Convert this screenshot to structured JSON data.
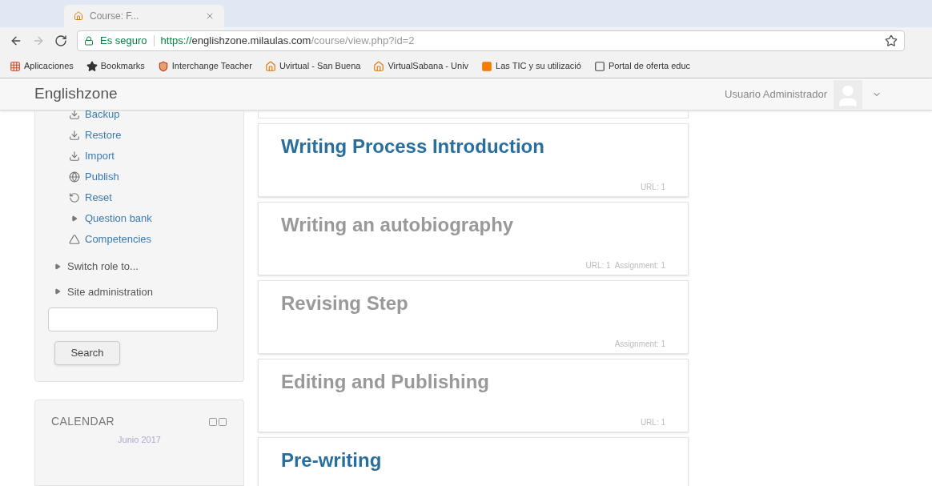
{
  "browser": {
    "tab": {
      "title": "Course: F..."
    },
    "address": {
      "secure_label": "Es seguro",
      "url_host": "https://englishzone.milaulas.com",
      "url_path": "/course/view.php?id=2"
    },
    "bookmarks": [
      {
        "label": "Aplicaciones"
      },
      {
        "label": "Bookmarks"
      },
      {
        "label": "Interchange Teacher"
      },
      {
        "label": "Uvirtual - San Buena"
      },
      {
        "label": "VirtualSabana - Univ"
      },
      {
        "label": "Las TIC y su utilizació"
      },
      {
        "label": "Portal de oferta educ"
      }
    ]
  },
  "navbar": {
    "brand": "Englishzone",
    "user": "Usuario Administrador"
  },
  "admin_menu": {
    "items": [
      {
        "label": "Backup"
      },
      {
        "label": "Restore"
      },
      {
        "label": "Import"
      },
      {
        "label": "Publish"
      },
      {
        "label": "Reset"
      },
      {
        "label": "Question bank"
      },
      {
        "label": "Competencies"
      }
    ],
    "sections": [
      {
        "label": "Switch role to...",
        "expanded": false
      },
      {
        "label": "Site administration",
        "expanded": false
      }
    ],
    "search_button": "Search"
  },
  "calendar": {
    "title": "CALENDAR",
    "month": "Junio 2017"
  },
  "course_sections": [
    {
      "title": "Writing Process Introduction",
      "visible": true,
      "summary": "URL: 1"
    },
    {
      "title": "Writing an autobiography",
      "visible": false,
      "summary": "URL: 1  Assignment: 1"
    },
    {
      "title": "Revising Step",
      "visible": false,
      "summary": "Assignment: 1"
    },
    {
      "title": "Editing and Publishing",
      "visible": false,
      "summary": "URL: 1"
    },
    {
      "title": "Pre-writing",
      "visible": true
    }
  ]
}
